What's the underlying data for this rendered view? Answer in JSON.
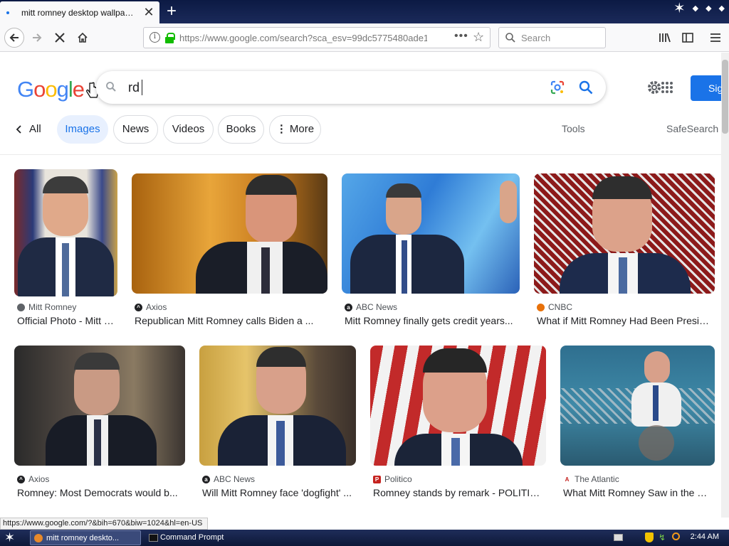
{
  "browser": {
    "tab_title": "mitt romney desktop wallpaper - Google Search",
    "url": "https://www.google.com/search?sca_esv=99dc5775480ade1",
    "search_placeholder": "Search"
  },
  "google": {
    "logo_text": "Google",
    "query": "rd",
    "signin_label": "Sig",
    "tabs": [
      "All",
      "Images",
      "News",
      "Videos",
      "Books",
      "More"
    ],
    "tools_label": "Tools",
    "safesearch_label": "SafeSearch"
  },
  "results": [
    {
      "source": "Mitt Romney",
      "caption": "Official Photo - Mitt Romney",
      "fav_color": "#5f6368"
    },
    {
      "source": "Axios",
      "caption": "Republican Mitt Romney calls Biden a ...",
      "fav_color": "#202124"
    },
    {
      "source": "ABC News",
      "caption": "Mitt Romney finally gets credit years...",
      "fav_color": "#202124"
    },
    {
      "source": "CNBC",
      "caption": "What if Mitt Romney Had Been President",
      "fav_color": "#e8710a"
    },
    {
      "source": "Axios",
      "caption": "Romney: Most Democrats would b...",
      "fav_color": "#202124"
    },
    {
      "source": "ABC News",
      "caption": "Will Mitt Romney face 'dogfight' ...",
      "fav_color": "#202124"
    },
    {
      "source": "Politico",
      "caption": "Romney stands by remark - POLITICO",
      "fav_color": "#c5221f"
    },
    {
      "source": "The Atlantic",
      "caption": "What Mitt Romney Saw in the Senate",
      "fav_color": "#c5221f"
    }
  ],
  "status_url": "https://www.google.com/?&bih=670&biw=1024&hl=en-US",
  "taskbar": {
    "items": [
      "mitt romney deskto...",
      "Command Prompt"
    ],
    "clock": "2:44 AM"
  }
}
